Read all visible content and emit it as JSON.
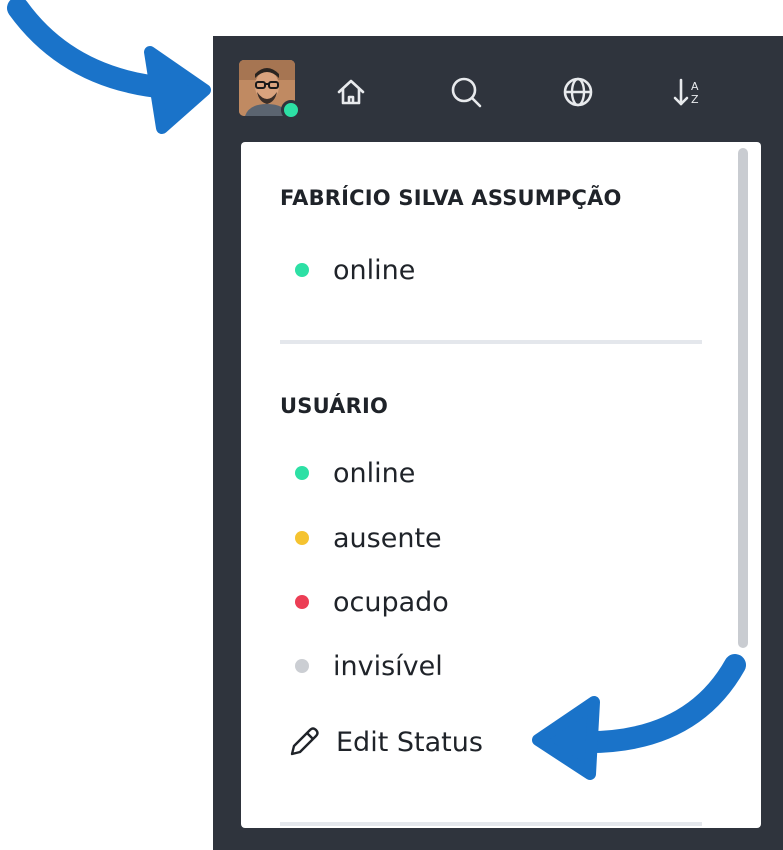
{
  "user": {
    "name": "FABRÍCIO SILVA ASSUMPÇÃO",
    "status": {
      "label": "online",
      "color": "#2de0a5"
    }
  },
  "topbar": {
    "icons": [
      "avatar",
      "home-icon",
      "search-icon",
      "globe-icon",
      "sort-az-icon"
    ],
    "sort_letter_top": "A",
    "sort_letter_bottom": "Z"
  },
  "status_section": {
    "title": "USUÁRIO",
    "items": [
      {
        "label": "online",
        "color": "#2de0a5"
      },
      {
        "label": "ausente",
        "color": "#f5c330"
      },
      {
        "label": "ocupado",
        "color": "#ec3e55"
      },
      {
        "label": "invisível",
        "color": "#cbced3"
      }
    ],
    "edit_label": "Edit Status"
  },
  "colors": {
    "sidebar_bg": "#2f343d",
    "arrow": "#1a73c9"
  }
}
